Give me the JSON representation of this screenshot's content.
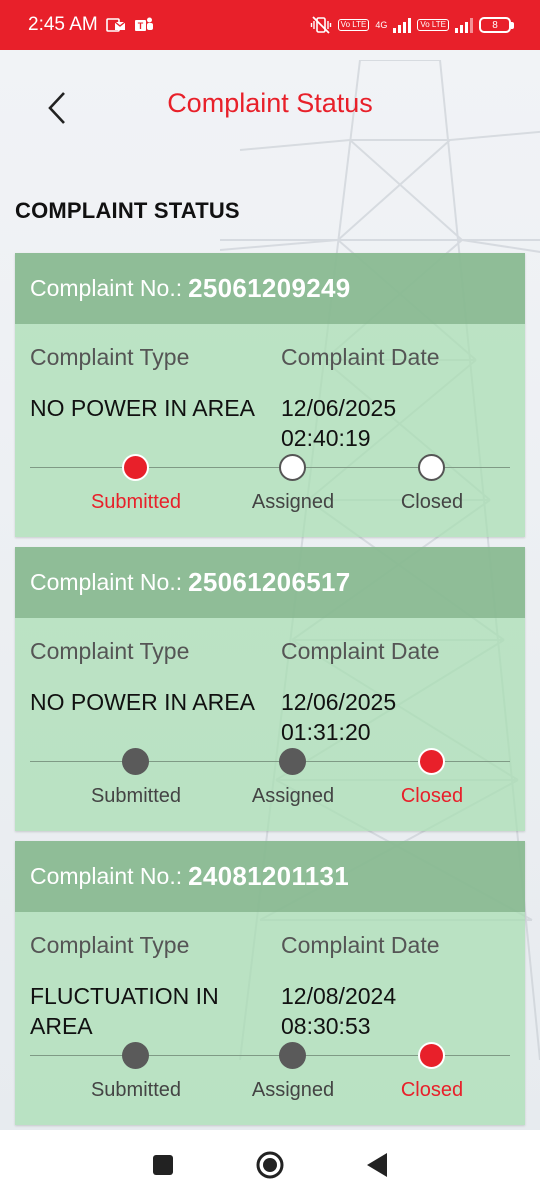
{
  "status_bar": {
    "time": "2:45 AM",
    "battery": "8",
    "network": "4G",
    "volte1": "Vo LTE",
    "volte2": "Vo LTE"
  },
  "header": {
    "title": "Complaint Status"
  },
  "section_title": "COMPLAINT STATUS",
  "labels": {
    "complaint_no": "Complaint No.:",
    "type": "Complaint Type",
    "date": "Complaint Date",
    "step_submitted": "Submitted",
    "step_assigned": "Assigned",
    "step_closed": "Closed"
  },
  "complaints": [
    {
      "number": "25061209249",
      "type": "NO POWER IN AREA",
      "date": "12/06/2025",
      "time": "02:40:19",
      "current_step": "Submitted"
    },
    {
      "number": "25061206517",
      "type": "NO POWER IN AREA",
      "date": "12/06/2025",
      "time": "01:31:20",
      "current_step": "Closed"
    },
    {
      "number": "24081201131",
      "type": "FLUCTUATION IN AREA",
      "date": "12/08/2024",
      "time": "08:30:53",
      "current_step": "Closed"
    }
  ],
  "colors": {
    "brand_red": "#e8202a",
    "card_green": "#a8deb2",
    "card_header": "#80b088"
  },
  "icons": {
    "back": "chevron-left-icon",
    "nav_recent": "square-icon",
    "nav_home": "circle-icon",
    "nav_back": "triangle-back-icon"
  }
}
